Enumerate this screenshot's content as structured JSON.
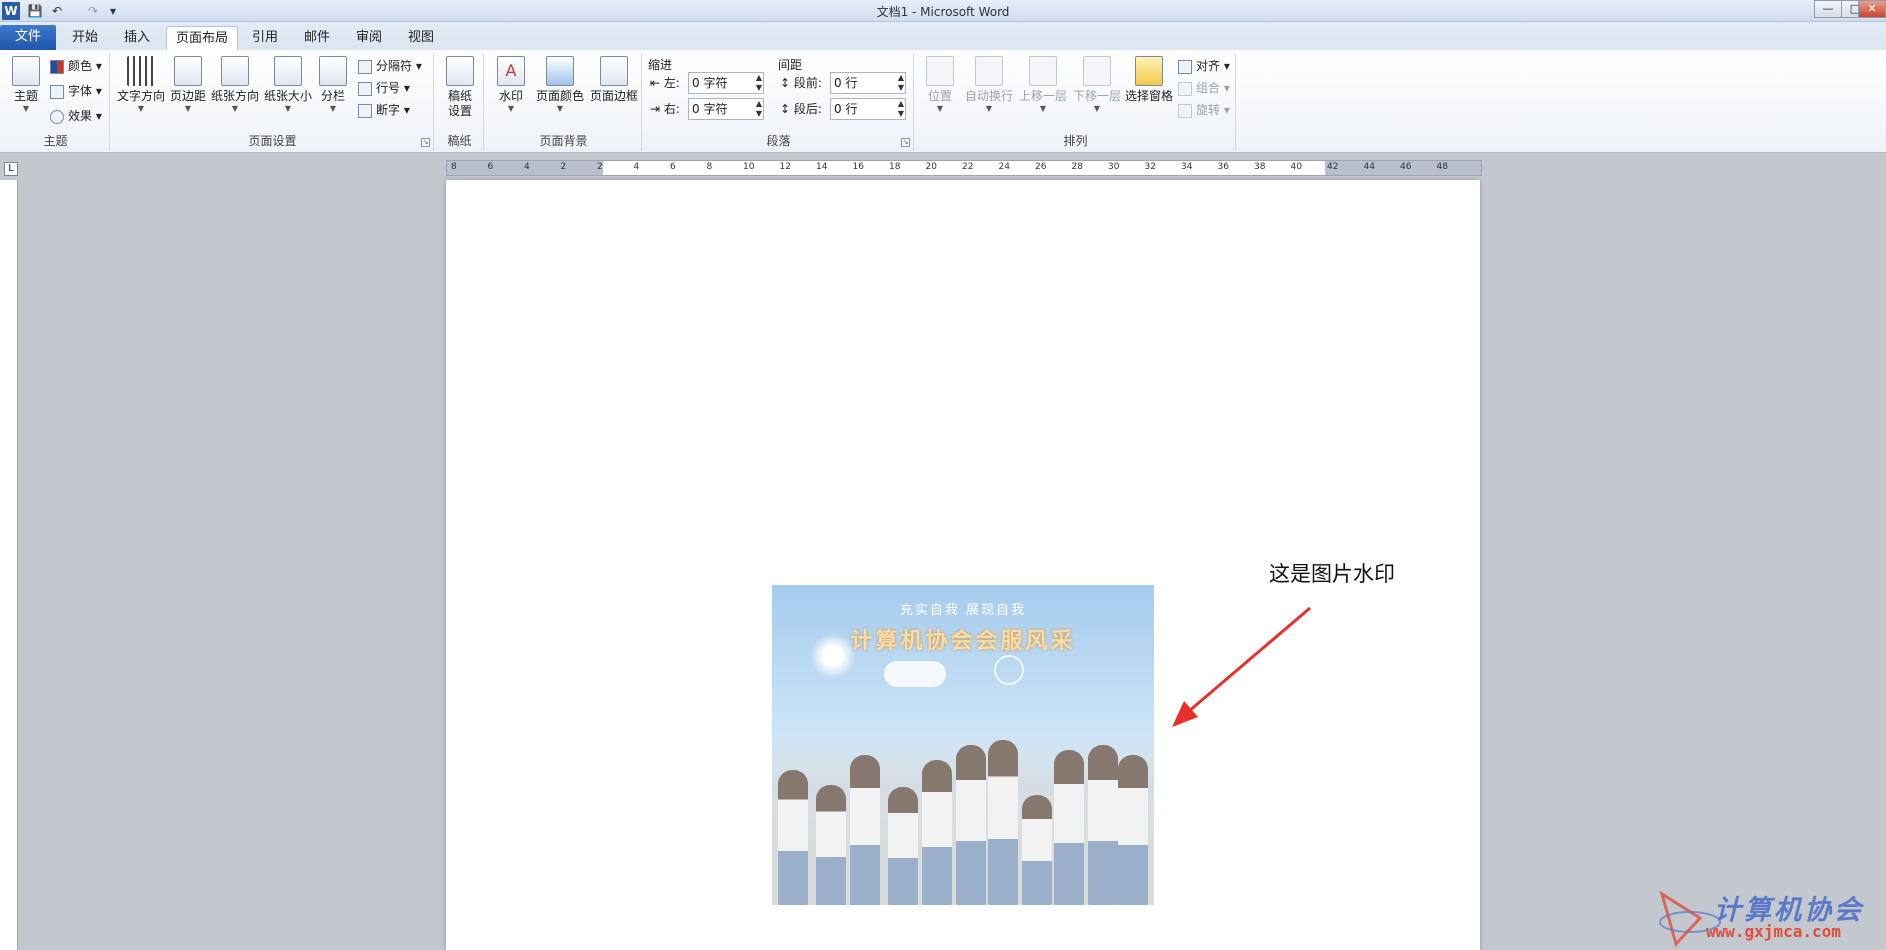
{
  "window": {
    "title": "文档1 - Microsoft Word",
    "controls": {
      "minimize": "—",
      "maximize": "□",
      "close": "✕"
    }
  },
  "quick_access": {
    "icons": [
      "word-logo-icon",
      "save-icon",
      "undo-icon",
      "redo-icon",
      "customize-icon"
    ],
    "glyphs": {
      "logo": "W",
      "save": "💾",
      "undo": "↶",
      "redo": "↷",
      "customize": "▾"
    }
  },
  "tabs": [
    "文件",
    "开始",
    "插入",
    "页面布局",
    "引用",
    "邮件",
    "审阅",
    "视图"
  ],
  "active_tab": "页面布局",
  "ribbon": {
    "theme": {
      "label": "主题",
      "big": "主题",
      "colors": "颜色",
      "fonts": "字体",
      "effects": "效果"
    },
    "page_setup": {
      "label": "页面设置",
      "text_direction": "文字方向",
      "margins": "页边距",
      "orientation": "纸张方向",
      "size": "纸张大小",
      "columns": "分栏",
      "breaks": "分隔符",
      "line_numbers": "行号",
      "hyphenation": "断字"
    },
    "manuscript": {
      "label": "稿纸",
      "button": "稿纸\n设置",
      "line1": "稿纸",
      "line2": "设置"
    },
    "page_background": {
      "label": "页面背景",
      "watermark": "水印",
      "page_color": "页面颜色",
      "page_borders": "页面边框"
    },
    "paragraph": {
      "label": "段落",
      "indent_title": "缩进",
      "left_label": "左:",
      "left_value": "0 字符",
      "right_label": "右:",
      "right_value": "0 字符",
      "spacing_title": "间距",
      "before_label": "段前:",
      "before_value": "0 行",
      "after_label": "段后:",
      "after_value": "0 行"
    },
    "arrange": {
      "label": "排列",
      "position": "位置",
      "wrap_text": "自动换行",
      "bring_forward": "上移一层",
      "send_backward": "下移一层",
      "selection_pane": "选择窗格",
      "align": "对齐",
      "group": "组合",
      "rotate": "旋转"
    }
  },
  "document": {
    "watermark_slogan": "充实自我    展现自我",
    "watermark_title": "计算机协会会服风采",
    "annotation": "这是图片水印",
    "arrow_color": "#e8302a"
  },
  "site_watermark": {
    "name": "计算机协会",
    "url": "www.gxjmca.com"
  },
  "ruler": {
    "h_numbers": [
      "8",
      "6",
      "4",
      "2",
      "2",
      "4",
      "6",
      "8",
      "10",
      "12",
      "14",
      "16",
      "18",
      "20",
      "22",
      "24",
      "26",
      "28",
      "30",
      "32",
      "34",
      "36",
      "38",
      "40",
      "42",
      "44",
      "46",
      "48"
    ]
  }
}
